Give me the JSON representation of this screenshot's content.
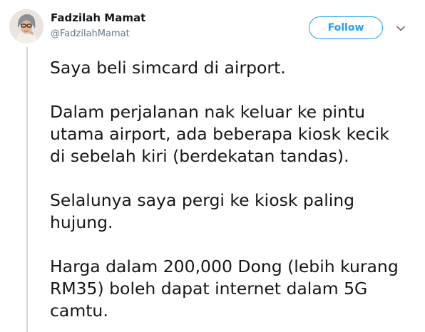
{
  "author": {
    "display_name": "Fadzilah Mamat",
    "handle": "@FadzilahMamat",
    "avatar_icon": "profile-photo"
  },
  "actions": {
    "follow_label": "Follow",
    "more_icon": "chevron-down-icon"
  },
  "colors": {
    "accent": "#1da1f2",
    "text": "#14171a",
    "muted": "#657786",
    "thread_line": "#ccd6dd"
  },
  "tweet": {
    "paragraphs": [
      "Saya beli simcard di airport.",
      "Dalam perjalanan nak keluar ke pintu\nutama airport, ada beberapa kiosk kecik\ndi sebelah kiri (berdekatan tandas).",
      "Selalunya saya pergi ke kiosk paling\nhujung.",
      "Harga dalam 200,000 Dong (lebih kurang\nRM35) boleh dapat internet dalam 5G\ncamtu."
    ]
  }
}
